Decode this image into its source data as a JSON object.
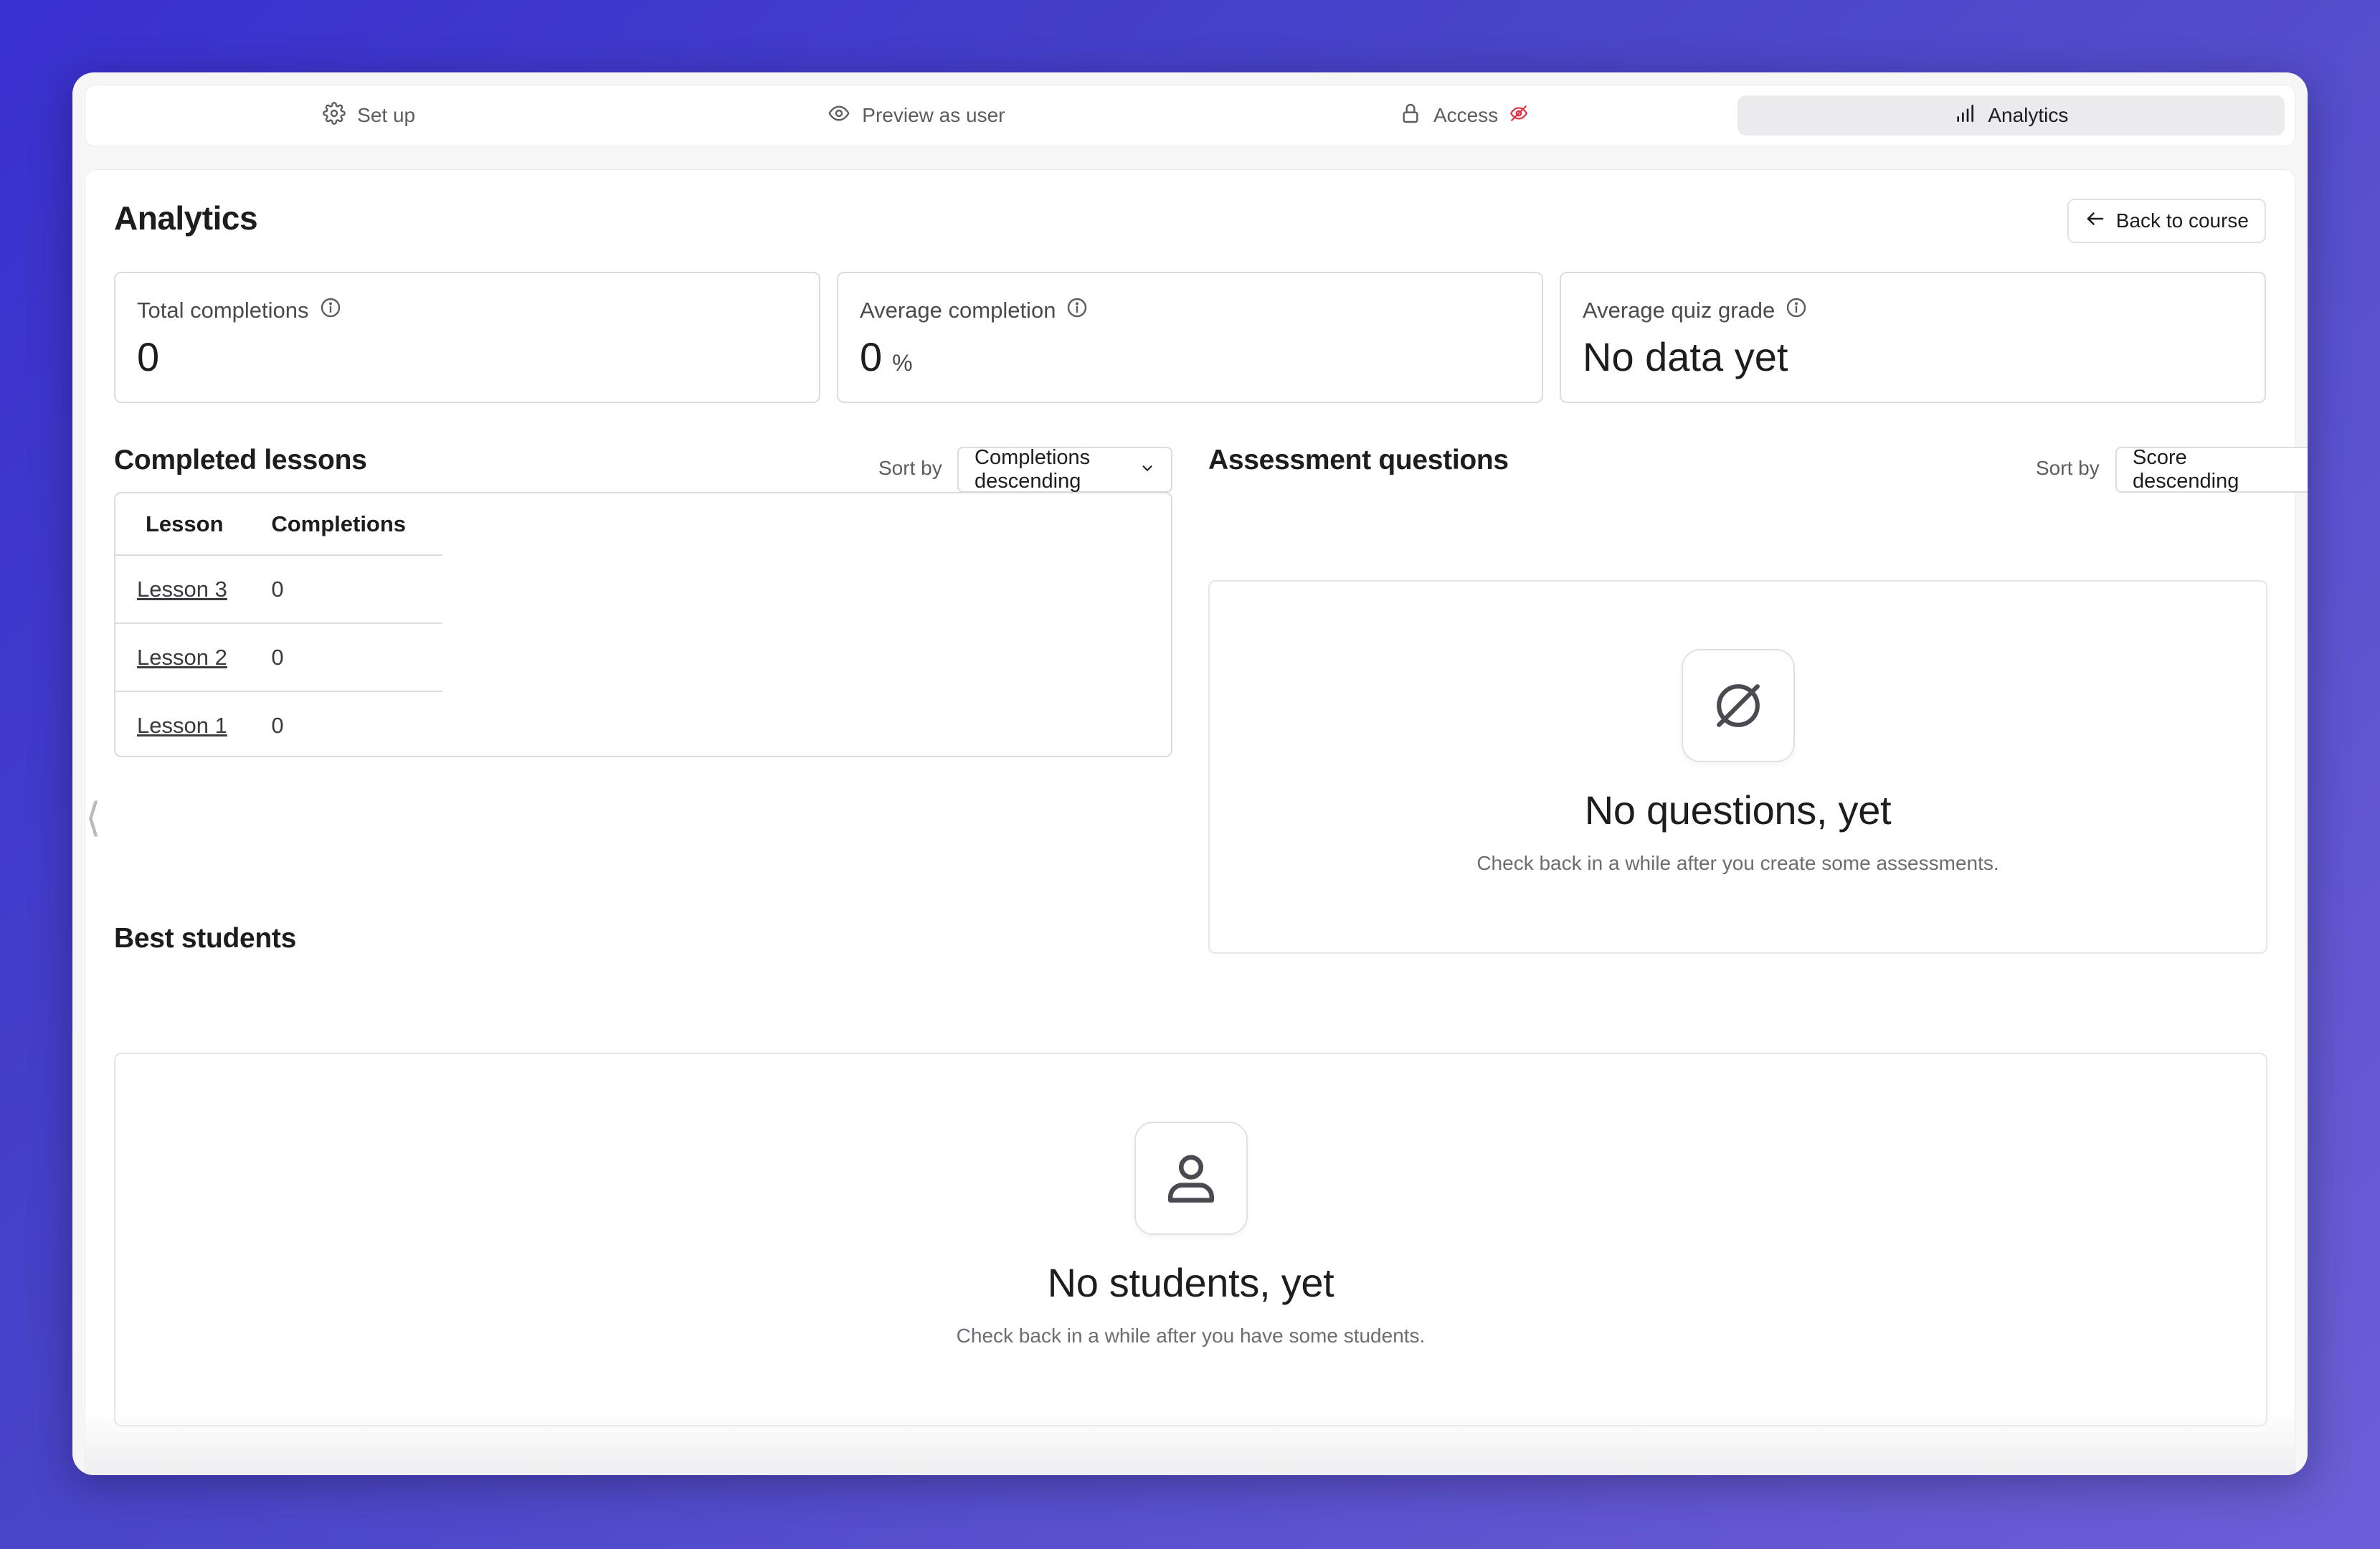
{
  "tabs": [
    {
      "label": "Set up",
      "icon": "gear-icon"
    },
    {
      "label": "Preview as user",
      "icon": "eye-icon"
    },
    {
      "label": "Access",
      "icon": "lock-icon",
      "badge_icon": "eye-off-icon",
      "badge_color": "#e0303f"
    },
    {
      "label": "Analytics",
      "icon": "bar-chart-icon",
      "active": true
    }
  ],
  "page": {
    "title": "Analytics",
    "back_label": "Back to course"
  },
  "stats": [
    {
      "label": "Total completions",
      "value": "0",
      "unit": ""
    },
    {
      "label": "Average completion",
      "value": "0",
      "unit": "%"
    },
    {
      "label": "Average quiz grade",
      "value": "No data yet",
      "unit": ""
    }
  ],
  "completed_lessons": {
    "title": "Completed lessons",
    "sort_label": "Sort by",
    "sort_value": "Completions descending",
    "columns": [
      "Lesson",
      "Completions"
    ],
    "rows": [
      {
        "lesson": "Lesson 3",
        "completions": "0"
      },
      {
        "lesson": "Lesson 2",
        "completions": "0"
      },
      {
        "lesson": "Lesson 1",
        "completions": "0"
      }
    ]
  },
  "assessment_questions": {
    "title": "Assessment questions",
    "sort_label": "Sort by",
    "sort_value": "Score descending",
    "empty_title": "No questions, yet",
    "empty_subtitle": "Check back in a while after you create some assessments.",
    "empty_icon": "empty-set-icon"
  },
  "best_students": {
    "title": "Best students",
    "empty_title": "No students, yet",
    "empty_subtitle": "Check back in a while after you have some students.",
    "empty_icon": "user-icon"
  },
  "sidebar_handle": "⟨",
  "colors": {
    "accent_badge": "#e0303f",
    "background_gradient_start": "#3a2fcf",
    "background_gradient_end": "#6a5fd6"
  }
}
